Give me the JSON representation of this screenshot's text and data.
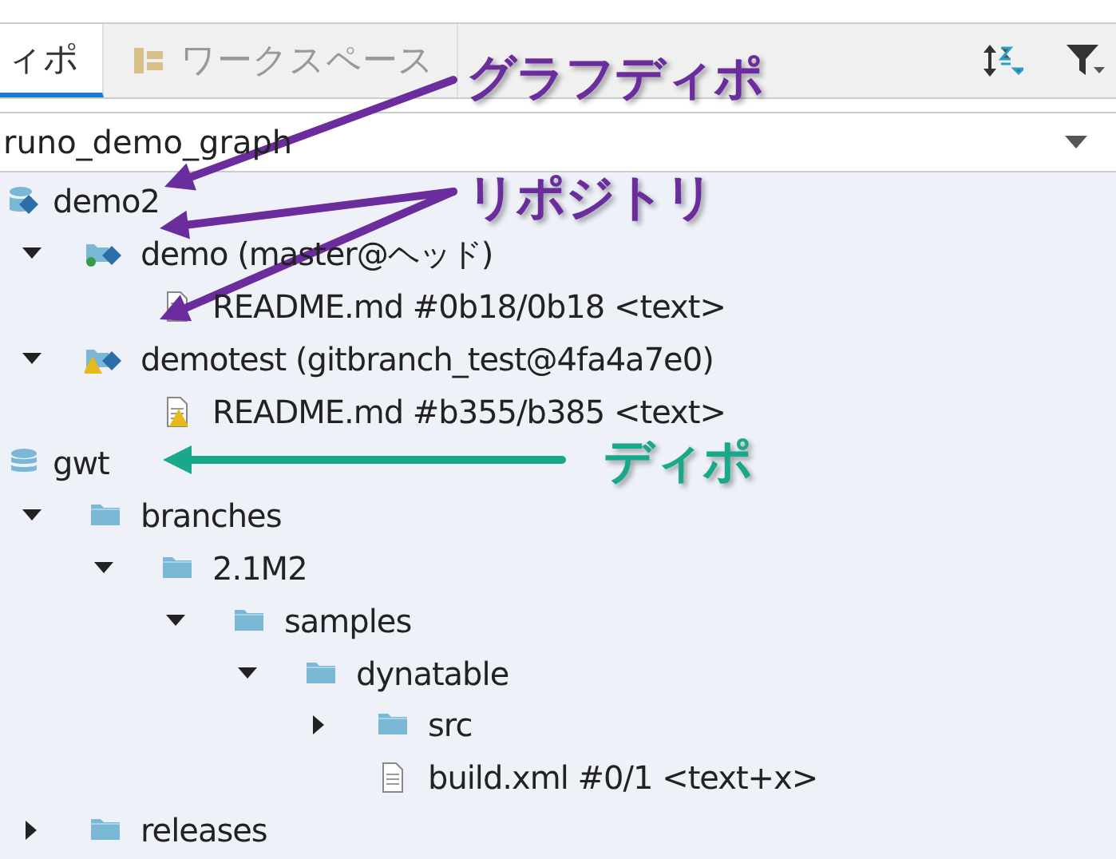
{
  "tabs": [
    {
      "label": "ィポ",
      "selected": true
    },
    {
      "label": "ワークスペース",
      "selected": false
    }
  ],
  "selector": {
    "value": "runo_demo_graph"
  },
  "tree": [
    {
      "label": "demo2",
      "kind": "graphdepot",
      "children": [
        {
          "label": "demo (master@ヘッド)",
          "kind": "reposynced",
          "expanded": true,
          "children": [
            {
              "label": "README.md #0b18/0b18 <text>",
              "kind": "file"
            }
          ]
        },
        {
          "label": "demotest (gitbranch_test@4fa4a7e0)",
          "kind": "repowarning",
          "expanded": true,
          "children": [
            {
              "label": "README.md #b355/b385 <text>",
              "kind": "filewarning"
            }
          ]
        }
      ]
    },
    {
      "label": "gwt",
      "kind": "depot",
      "children": [
        {
          "label": "branches",
          "kind": "folder",
          "expanded": true,
          "children": [
            {
              "label": "2.1M2",
              "kind": "folder",
              "expanded": true,
              "children": [
                {
                  "label": "samples",
                  "kind": "folder",
                  "expanded": true,
                  "children": [
                    {
                      "label": "dynatable",
                      "kind": "folder",
                      "expanded": true,
                      "children": [
                        {
                          "label": "src",
                          "kind": "folder",
                          "expanded": false
                        },
                        {
                          "label": "build.xml #0/1 <text+x>",
                          "kind": "file"
                        }
                      ]
                    }
                  ]
                }
              ]
            }
          ]
        },
        {
          "label": "releases",
          "kind": "folder",
          "expanded": false
        }
      ]
    }
  ],
  "annotations": [
    {
      "text": "グラフディポ",
      "color": "#6b2c9e"
    },
    {
      "text": "リポジトリ",
      "color": "#6b2c9e"
    },
    {
      "text": "ディポ",
      "color": "#1aa88a"
    }
  ]
}
